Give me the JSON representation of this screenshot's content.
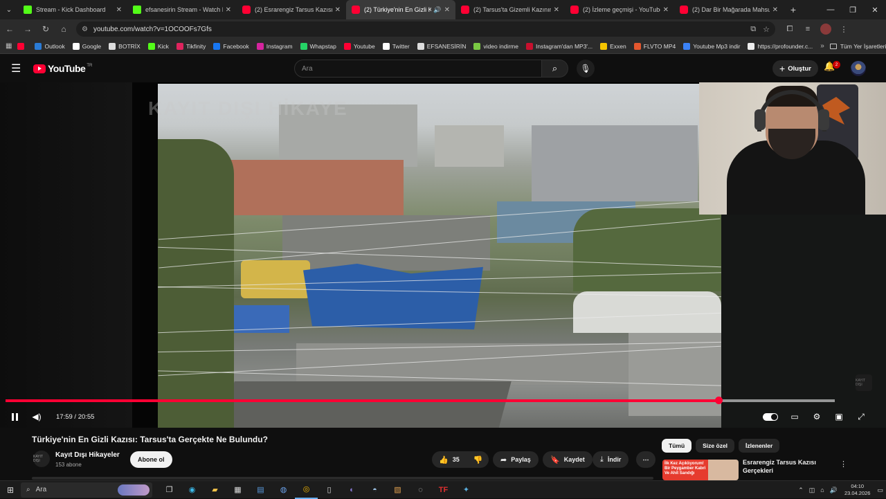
{
  "browser": {
    "tabs": [
      {
        "title": "Stream - Kick Dashboard",
        "icon": "kick",
        "active": false
      },
      {
        "title": "efsanesirin Stream - Watch Live",
        "icon": "kick",
        "active": false
      },
      {
        "title": "(2) Esrarengiz Tarsus Kazısı Ger",
        "icon": "youtube",
        "active": false
      },
      {
        "title": "(2) Türkiye'nin En Gizli Kazı",
        "icon": "youtube",
        "active": true
      },
      {
        "title": "(2) Tarsus'ta Gizemli Kazının Yap",
        "icon": "youtube",
        "active": false
      },
      {
        "title": "(2) İzleme geçmişi - YouTube",
        "icon": "youtube",
        "active": false
      },
      {
        "title": "(2) Dar Bir Mağarada Mahsur K",
        "icon": "youtube",
        "active": false
      }
    ],
    "url": "youtube.com/watch?v=1OCOOFs7Gfs",
    "bookmarks": [
      {
        "label": "",
        "color": "#ff0033"
      },
      {
        "label": "Outlook",
        "color": "#2a7bd6"
      },
      {
        "label": "Google",
        "color": "#ffffff"
      },
      {
        "label": "BOTRİX",
        "color": "#dddddd"
      },
      {
        "label": "Kick",
        "color": "#53fc18"
      },
      {
        "label": "Tikfinity",
        "color": "#e0245e"
      },
      {
        "label": "Facebook",
        "color": "#1877f2"
      },
      {
        "label": "Instagram",
        "color": "#d6249f"
      },
      {
        "label": "Whapstap",
        "color": "#25d366"
      },
      {
        "label": "Youtube",
        "color": "#ff0033"
      },
      {
        "label": "Twitter",
        "color": "#ffffff"
      },
      {
        "label": "EFSANESİRİN",
        "color": "#dddddd"
      },
      {
        "label": "video indirme",
        "color": "#7ac943"
      },
      {
        "label": "Instagram'dan MP3'...",
        "color": "#c8102e"
      },
      {
        "label": "Exxen",
        "color": "#f5c400"
      },
      {
        "label": "FLVTO MP4",
        "color": "#e4572e"
      },
      {
        "label": "Youtube Mp3 indir",
        "color": "#3b82f6"
      },
      {
        "label": "https://profounder.c...",
        "color": "#eeeeee"
      }
    ],
    "all_bookmarks": "Tüm Yer İşaretleri"
  },
  "youtube": {
    "logo_text": "YouTube",
    "logo_country": "TR",
    "search_placeholder": "Ara",
    "create_label": "Oluştur",
    "notification_count": "2"
  },
  "player": {
    "time_display": "17:59 / 20:55",
    "progress_fraction": 0.86,
    "buffer_fraction": 1.0,
    "watermark_text": "KAYIT DIŞI HİKAYE",
    "corner_logo_text": "KAYIT DIŞI"
  },
  "video": {
    "title": "Türkiye'nin En Gizli Kazısı: Tarsus'ta Gerçekte Ne Bulundu?",
    "channel": "Kayıt Dışı Hikayeler",
    "channel_avatar_text": "KAYIT DIŞI",
    "subscribers": "153 abone",
    "subscribe_label": "Abone ol",
    "likes": "35",
    "share_label": "Paylaş",
    "save_label": "Kaydet",
    "download_label": "İndir"
  },
  "sidebar": {
    "chips": [
      "Tümü",
      "Size özel",
      "İzlenenler"
    ],
    "recommendation": {
      "title": "Esrarengiz Tarsus Kazısı Gerçekleri",
      "thumb_text": "İlk Kez Açıklıyorum! Bir Peygamber Kabri Ve Ahit Sandığı"
    }
  },
  "taskbar": {
    "search_label": "Ara",
    "time": "04:10",
    "date": "23.04.2026"
  }
}
